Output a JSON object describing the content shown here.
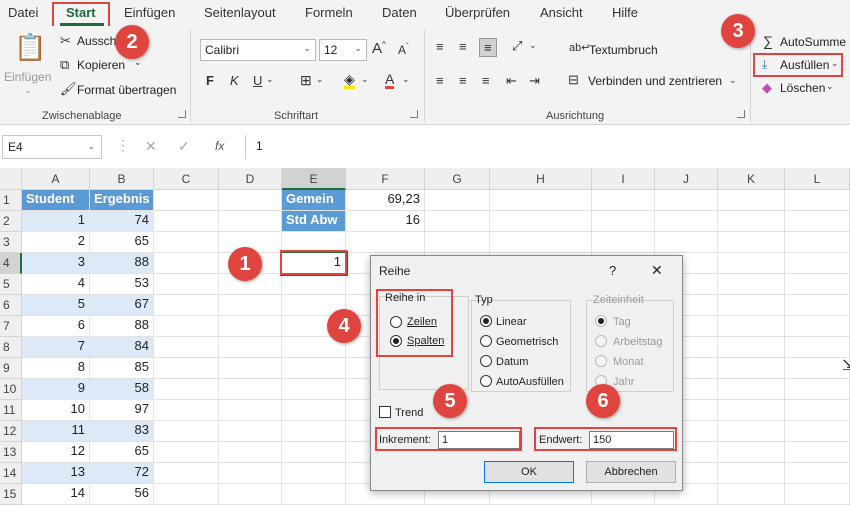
{
  "menu": [
    "Datei",
    "Start",
    "Einfügen",
    "Seitenlayout",
    "Formeln",
    "Daten",
    "Überprüfen",
    "Ansicht",
    "Hilfe"
  ],
  "ribbon": {
    "clipboard": {
      "paste": "Einfügen",
      "cut": "Ausschn",
      "copy": "Kopieren",
      "format_painter": "Format übertragen",
      "group": "Zwischenablage"
    },
    "font": {
      "name": "Calibri",
      "size": "12",
      "bold": "F",
      "italic": "K",
      "underline": "U",
      "group": "Schriftart"
    },
    "alignment": {
      "wrap": "Textumbruch",
      "merge": "Verbinden und zentrieren",
      "group": "Ausrichtung"
    },
    "editing": {
      "autosum": "AutoSumme",
      "fill": "Ausfüllen",
      "clear": "Löschen"
    }
  },
  "formula_bar": {
    "namebox": "E4",
    "fx": "fx",
    "value": "1"
  },
  "columns": [
    "A",
    "B",
    "C",
    "D",
    "E",
    "F",
    "G",
    "H",
    "I",
    "J",
    "K",
    "L"
  ],
  "rows": [
    "1",
    "2",
    "3",
    "4",
    "5",
    "6",
    "7",
    "8",
    "9",
    "10",
    "11",
    "12",
    "13",
    "14",
    "15"
  ],
  "table": {
    "header": [
      "Student",
      "Ergebnis"
    ],
    "students": [
      "1",
      "2",
      "3",
      "4",
      "5",
      "6",
      "7",
      "8",
      "9",
      "10",
      "11",
      "12",
      "13",
      "14"
    ],
    "scores": [
      "74",
      "65",
      "88",
      "53",
      "67",
      "88",
      "84",
      "85",
      "58",
      "97",
      "83",
      "65",
      "72",
      "56"
    ]
  },
  "stats": {
    "mean_label": "Gemein",
    "mean_value": "69,23",
    "std_label": "Std Abw",
    "std_value": "16"
  },
  "e4_value": "1",
  "badges": [
    "1",
    "2",
    "3",
    "4",
    "5",
    "6"
  ],
  "dialog": {
    "title": "Reihe",
    "help": "?",
    "close": "✕",
    "series_in": "Reihe in",
    "rows": "Zeilen",
    "columns": "Spalten",
    "type": "Typ",
    "linear": "Linear",
    "growth": "Geometrisch",
    "date": "Datum",
    "autofill": "AutoAusfüllen",
    "date_unit": "Zeiteinheit",
    "day": "Tag",
    "weekday": "Arbeitstag",
    "month": "Monat",
    "year": "Jahr",
    "trend": "Trend",
    "step_label": "Inkrement:",
    "step_value": "1",
    "stop_label": "Endwert:",
    "stop_value": "150",
    "ok": "OK",
    "cancel": "Abbrechen"
  },
  "colors": {
    "accent": "#e0443e",
    "header": "#5b9bd5",
    "band": "#dde9f6"
  }
}
